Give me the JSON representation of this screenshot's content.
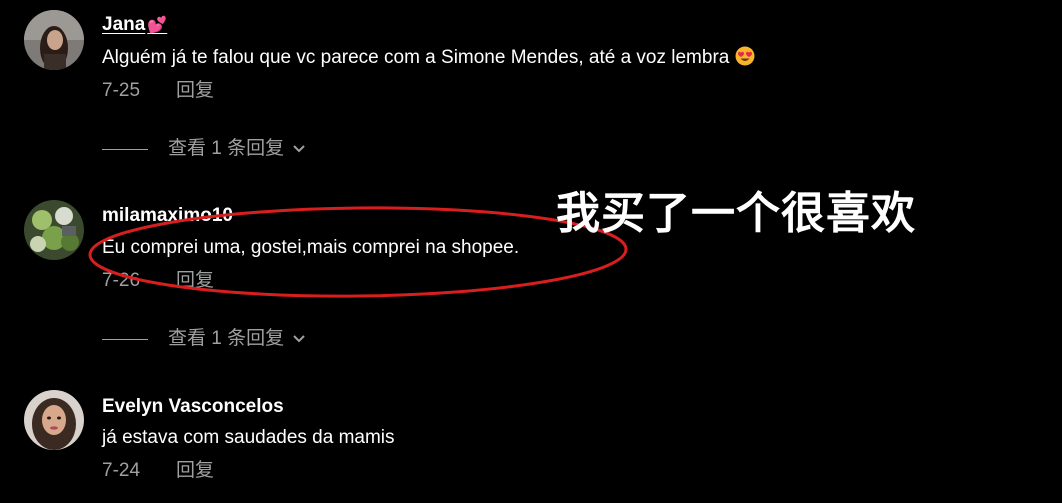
{
  "comments": [
    {
      "username": "Jana",
      "username_suffix": "💕",
      "text": "Alguém já te falou que vc parece com a Simone Mendes, até a voz lembra",
      "text_emoji": "heart-eyes-emoji",
      "date": "7-25",
      "reply_label": "回复",
      "view_replies_label": "查看 1 条回复"
    },
    {
      "username": "milamaximo10",
      "text": "Eu comprei uma, gostei,mais comprei na shopee.",
      "date": "7-26",
      "reply_label": "回复",
      "view_replies_label": "查看 1 条回复"
    },
    {
      "username": "Evelyn Vasconcelos",
      "text": "já estava com saudades da mamis",
      "date": "7-24",
      "reply_label": "回复"
    }
  ],
  "overlay": {
    "caption": "我买了一个很喜欢",
    "annotation_color": "#d81e1e"
  },
  "colors": {
    "background": "#000000",
    "primary_text": "#ffffff",
    "secondary_text": "#a0a0a0",
    "heart": "#ff3d7a"
  }
}
